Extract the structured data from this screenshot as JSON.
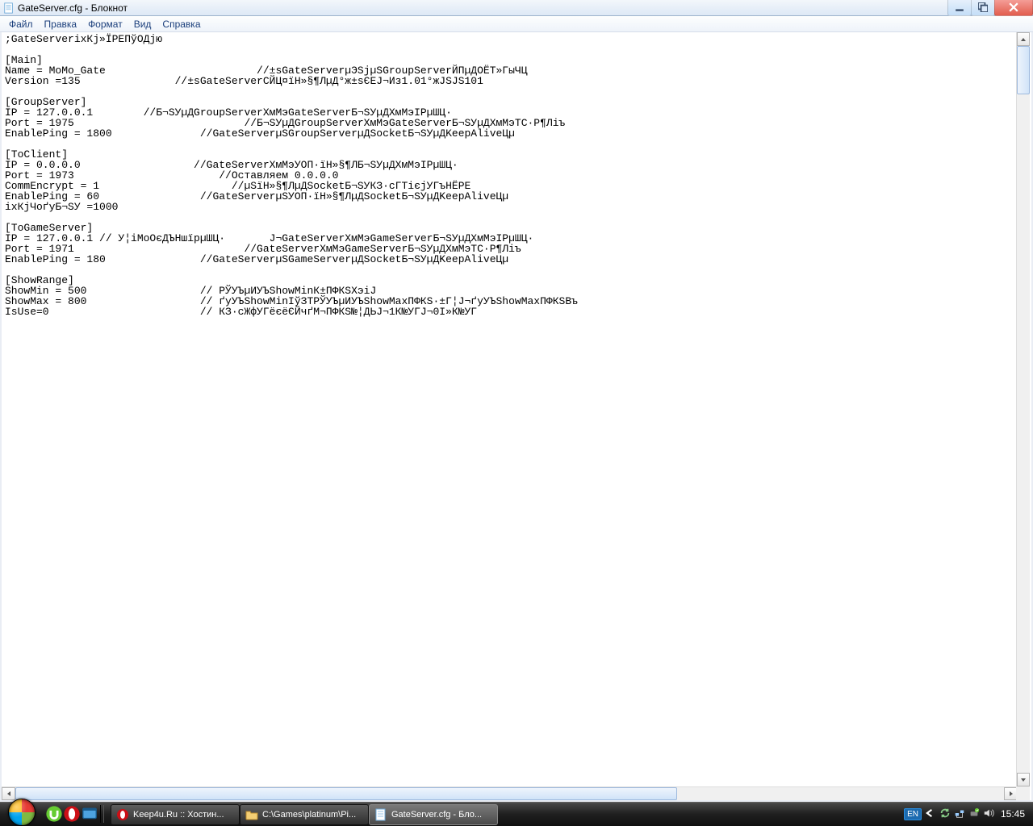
{
  "window": {
    "title": "GateServer.cfg - Блокнот"
  },
  "menu": {
    "file": "Файл",
    "edit": "Правка",
    "format": "Формат",
    "view": "Вид",
    "help": "Справка"
  },
  "content": ";GateServerіхКј»ЇРЕПўОДјю\n\n[Main]\nName = MoMo_Gate                        //±ѕGateServerµЭЅјµЅGroupServerЙПµДОЁТ»ГыЧЦ\nVersion =135               //±ѕGateServerСЙЦ¤їН»§¶ЛµД°ж±ѕЄЕЈ¬Из1.01°жЈЅЈЅ101\n\n[GroupServer]\nIP = 127.0.0.1        //Б¬ЅУµДGroupServerХмМэGateServerБ¬ЅУµДХмМэІРµШЦ·\nPort = 1975                           //Б¬ЅУµДGroupServerХмМэGateServerБ¬ЅУµДХмМэТС·Р¶Ліъ\nEnablePing = 1800              //GateServerµЅGroupServerµДSocketБ¬ЅУµДKeepAliveЦµ\n\n[ToClient]\nIP = 0.0.0.0                  //GateServerХмМэУОП·їН»§¶ЛБ¬ЅУµДХмМэІРµШЦ·\nPort = 1973                       //Оставляем 0.0.0.0\nCommEncrypt = 1                     //µЅїН»§¶ЛµДSocketБ¬ЅУКЗ·сГТієјУГъНЁРЕ\nEnablePing = 60                //GateServerµЅУОП·їН»§¶ЛµДSocketБ¬ЅУµДKeepAliveЦµ\nіхКјЧоґуБ¬ЅУ =1000\n\n[ToGameServer]\nIP = 127.0.0.1 // У¦іМоОєДЪНшїрµШЦ·       Ј¬GateServerХмМэGameServerБ¬ЅУµДХмМэІРµШЦ·\nPort = 1971                           //GateServerХмМэGameServerБ¬ЅУµДХмМэТС·Р¶Ліъ\nEnablePing = 180               //GateServerµЅGameServerµДSocketБ¬ЅУµДKeepAliveЦµ\n\n[ShowRange]\nShowMin = 500                  // РЎУЪµИУЪShowMinК±ПФКЅХэіЈ\nShowMax = 800                  // ґуУЪShowMinІўЗТРЎУЪµИУЪShowMaxПФКЅ·±Г¦Ј¬ґуУЪShowMaxПФКЅВъ\nIsUse=0                        // КЗ·сЖфУГёєёЄЙчґМ¬ПФКЅ№¦ДЬЈ¬1К№УГЈ¬0І»К№УГ",
  "taskbar": {
    "tasks": [
      {
        "label": "Keep4u.Ru :: Хостин..."
      },
      {
        "label": "C:\\Games\\platinum\\Pi..."
      },
      {
        "label": "GateServer.cfg - Бло..."
      }
    ],
    "lang": "EN",
    "clock": "15:45"
  }
}
